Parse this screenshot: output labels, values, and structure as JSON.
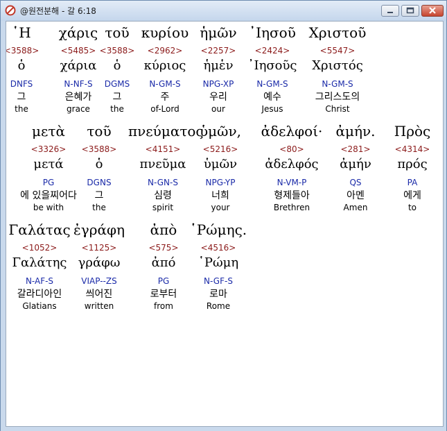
{
  "window": {
    "title": "@원전분해 - 갈 6:18",
    "icon": "no-entry-icon"
  },
  "colors": {
    "strongs": "#8b1a1a",
    "parse": "#1a2aa8",
    "text": "#000000"
  },
  "verse": {
    "rows": [
      {
        "words": [
          {
            "greek": "῾Η",
            "strongs": "<3588>",
            "lexeme": "ὁ",
            "parse": "DNFS",
            "korean": "그",
            "english": "the",
            "selected": true
          },
          {
            "greek": "χάρις",
            "strongs": "<5485>",
            "lexeme": "χάρια",
            "parse": "N-NF-S",
            "korean": "은혜가",
            "english": "grace"
          },
          {
            "greek": "τοῦ",
            "strongs": "<3588>",
            "lexeme": "ὁ",
            "parse": "DGMS",
            "korean": "그",
            "english": "the"
          },
          {
            "greek": "κυρίου",
            "strongs": "<2962>",
            "lexeme": "κύριος",
            "parse": "N-GM-S",
            "korean": "주",
            "english": "of-Lord"
          },
          {
            "greek": "ἡμῶν",
            "strongs": "<2257>",
            "lexeme": "ἡμἑν",
            "parse": "NPG-XP",
            "korean": "우리",
            "english": "our"
          },
          {
            "greek": "᾿Ιησοῦ",
            "strongs": "<2424>",
            "lexeme": "᾿Ιησοῦς",
            "parse": "N-GM-S",
            "korean": "예수",
            "english": "Jesus"
          },
          {
            "greek": "Χριστοῦ",
            "strongs": "<5547>",
            "lexeme": "Χριστός",
            "parse": "N-GM-S",
            "korean": "그리스도의",
            "english": "Christ"
          }
        ]
      },
      {
        "words": [
          {
            "greek": "μετὰ",
            "strongs": "<3326>",
            "lexeme": "μετά",
            "parse": "PG",
            "korean": "에 있을찌어다",
            "english": "be with"
          },
          {
            "greek": "τοῦ",
            "strongs": "<3588>",
            "lexeme": "ὁ",
            "parse": "DGNS",
            "korean": "그",
            "english": "the"
          },
          {
            "greek": "πνεύματος",
            "strongs": "<4151>",
            "lexeme": "πνεῦμα",
            "parse": "N-GN-S",
            "korean": "심령",
            "english": "spirit"
          },
          {
            "greek": "ὑμῶν,",
            "strongs": "<5216>",
            "lexeme": "ὑμῶν",
            "parse": "NPG-YP",
            "korean": "너희",
            "english": "your"
          },
          {
            "greek": "ἀδελφοί·",
            "strongs": "<80>",
            "lexeme": "ἀδελφός",
            "parse": "N-VM-P",
            "korean": "형제들아",
            "english": "Brethren"
          },
          {
            "greek": "ἀμήν.",
            "strongs": "<281>",
            "lexeme": "ἀμήν",
            "parse": "QS",
            "korean": "아멘",
            "english": "Amen"
          },
          {
            "greek": "Πρὸς",
            "strongs": "<4314>",
            "lexeme": "πρός",
            "parse": "PA",
            "korean": "에게",
            "english": "to"
          }
        ]
      },
      {
        "words": [
          {
            "greek": "Γαλάτας",
            "strongs": "<1052>",
            "lexeme": "Γαλάτης",
            "parse": "N-AF-S",
            "korean": "갈라디아인",
            "english": "Glatians"
          },
          {
            "greek": "ἐγράφη",
            "strongs": "<1125>",
            "lexeme": "γράφω",
            "parse": "VIAP--ZS",
            "korean": "씌어진",
            "english": "written"
          },
          {
            "greek": "ἀπὸ",
            "strongs": "<575>",
            "lexeme": "ἀπό",
            "parse": "PG",
            "korean": "로부터",
            "english": "from"
          },
          {
            "greek": "῾Ρώμης.",
            "strongs": "<4516>",
            "lexeme": "῾Ρώμη",
            "parse": "N-GF-S",
            "korean": "로마",
            "english": "Rome"
          }
        ]
      }
    ]
  }
}
